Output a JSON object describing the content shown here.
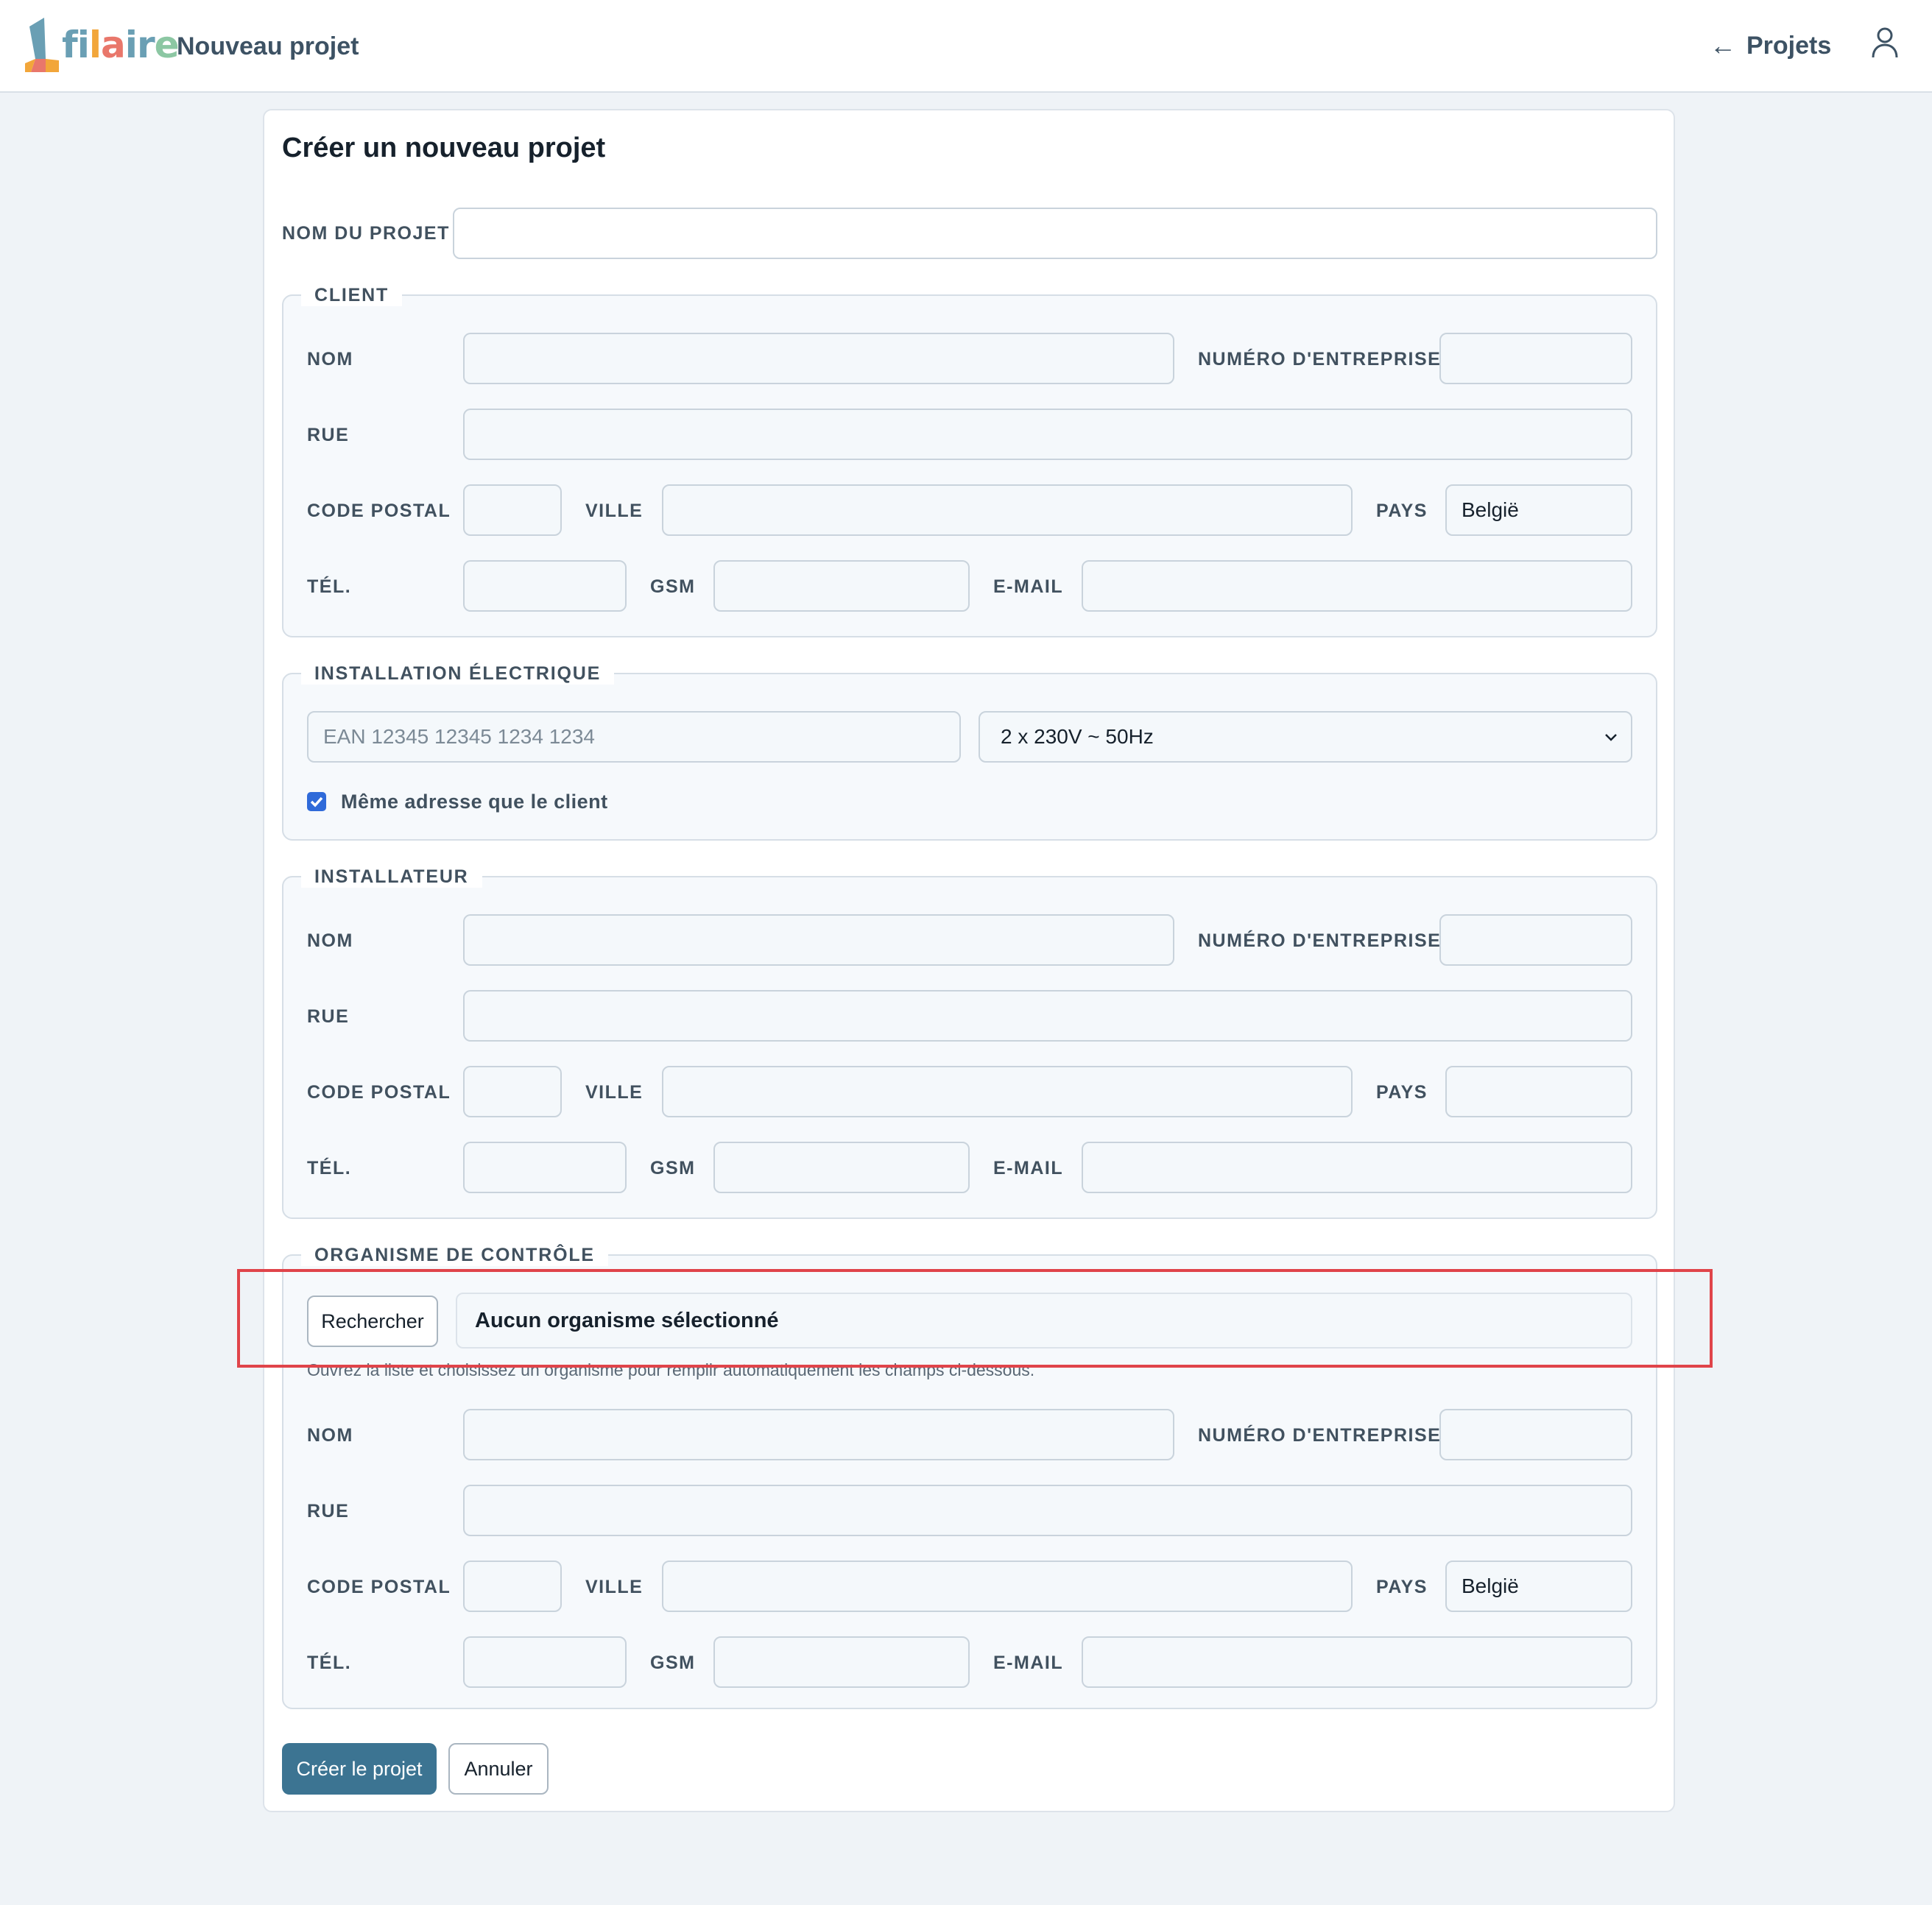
{
  "header": {
    "logo_text": [
      "fi",
      "l",
      "a",
      "i",
      "r",
      "e"
    ],
    "page_title": "Nouveau projet",
    "nav_arrow": "←",
    "nav_projects_label": "Projets"
  },
  "form": {
    "title": "Créer un nouveau projet",
    "project_name_label": "NOM DU PROJET",
    "project_name_value": "",
    "client": {
      "legend": "CLIENT",
      "name_label": "NOM",
      "company_number_label": "NUMÉRO D'ENTREPRISE",
      "street_label": "RUE",
      "postal_code_label": "CODE POSTAL",
      "city_label": "VILLE",
      "country_label": "PAYS",
      "country_value": "België",
      "phone_label": "TÉL.",
      "mobile_label": "GSM",
      "email_label": "E-MAIL"
    },
    "installation": {
      "legend": "INSTALLATION ÉLECTRIQUE",
      "ean_placeholder": "EAN 12345 12345 1234 1234",
      "voltage_value": "2 x 230V ~ 50Hz",
      "same_address_label": "Même adresse que le client",
      "same_address_checked": true
    },
    "installer": {
      "legend": "INSTALLATEUR",
      "name_label": "NOM",
      "company_number_label": "NUMÉRO D'ENTREPRISE",
      "street_label": "RUE",
      "postal_code_label": "CODE POSTAL",
      "city_label": "VILLE",
      "country_label": "PAYS",
      "country_value": "",
      "phone_label": "TÉL.",
      "mobile_label": "GSM",
      "email_label": "E-MAIL"
    },
    "control_body": {
      "legend": "ORGANISME DE CONTRÔLE",
      "search_button": "Rechercher",
      "selected_text": "Aucun organisme sélectionné",
      "hint": "Ouvrez la liste et choisissez un organisme pour remplir automatiquement les champs ci-dessous.",
      "name_label": "NOM",
      "company_number_label": "NUMÉRO D'ENTREPRISE",
      "street_label": "RUE",
      "postal_code_label": "CODE POSTAL",
      "city_label": "VILLE",
      "country_label": "PAYS",
      "country_value": "België",
      "phone_label": "TÉL.",
      "mobile_label": "GSM",
      "email_label": "E-MAIL"
    },
    "actions": {
      "create_label": "Créer le projet",
      "cancel_label": "Annuler"
    }
  },
  "colors": {
    "primary": "#3c7492",
    "checkbox": "#2f6ad9",
    "highlight": "#e0444a",
    "page_bg": "#eff3f7"
  }
}
